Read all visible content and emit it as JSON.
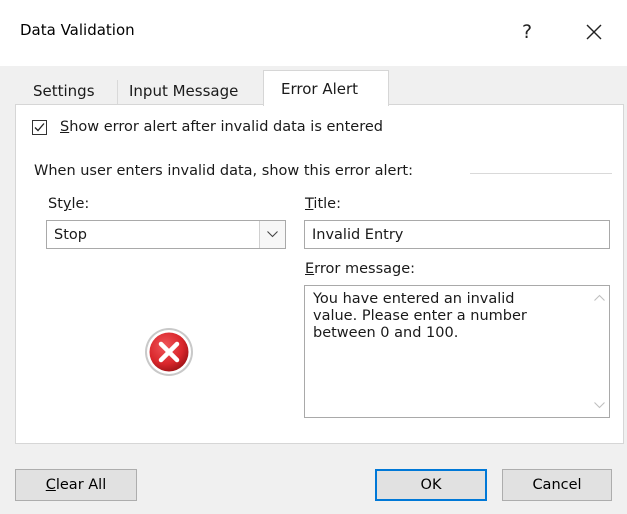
{
  "window": {
    "title": "Data Validation",
    "help_glyph": "?",
    "close_glyph": "✕"
  },
  "tabs": [
    {
      "label": "Settings"
    },
    {
      "label": "Input Message"
    },
    {
      "label": "Error Alert",
      "active": true
    }
  ],
  "error_alert": {
    "show_checkbox": {
      "checked": true,
      "label_mnemonic": "S",
      "label_rest": "how error alert after invalid data is entered"
    },
    "group_label": "When user enters invalid data, show this error alert:",
    "style": {
      "label_pre": "St",
      "label_mnemonic": "y",
      "label_post": "le:",
      "value": "Stop",
      "icon": "stop-error-icon"
    },
    "title": {
      "label_mnemonic": "T",
      "label_rest": "itle:",
      "value": "Invalid Entry"
    },
    "error_message": {
      "label_mnemonic": "E",
      "label_rest": "rror message:",
      "value": "You have entered an invalid\nvalue. Please enter a number\nbetween 0 and 100."
    }
  },
  "buttons": {
    "clear_all": {
      "mnemonic": "C",
      "rest": "lear All"
    },
    "ok": "OK",
    "cancel": "Cancel"
  },
  "colors": {
    "accent": "#0078d7",
    "stop_red": "#d9262b"
  }
}
